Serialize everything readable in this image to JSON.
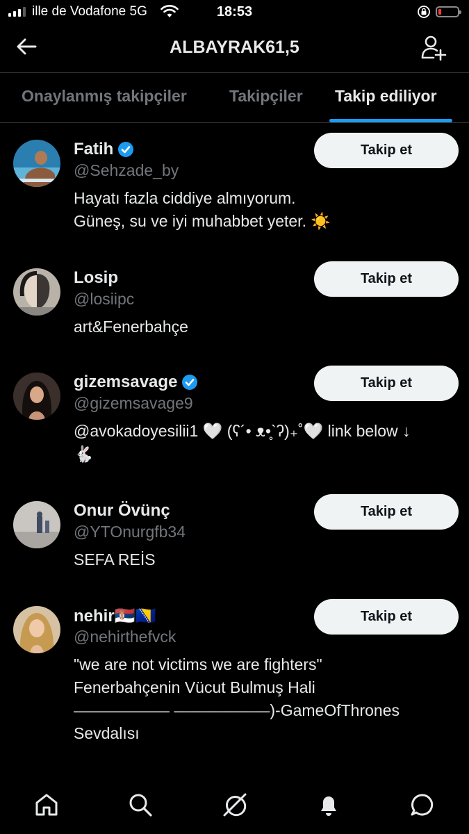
{
  "status_bar": {
    "carrier": "ille de Vodafone 5G",
    "time": "18:53"
  },
  "header": {
    "title": "ALBAYRAK61,5"
  },
  "tabs": [
    {
      "label": "Onaylanmış takipçiler"
    },
    {
      "label": "Takipçiler"
    },
    {
      "label": "Takip ediliyor"
    }
  ],
  "colors": {
    "accent": "#1d9bf0",
    "background": "#000000",
    "button_bg": "#eff3f4",
    "muted_text": "#71767b"
  },
  "users": [
    {
      "name": "Fatih",
      "handle": "@Sehzade_by",
      "verified": true,
      "bio": "Hayatı fazla ciddiye almıyorum.\nGüneş, su ve iyi muhabbet yeter. ☀️",
      "follow_label": "Takip et"
    },
    {
      "name": "Losip",
      "handle": "@losiipc",
      "verified": false,
      "bio": "art&Fenerbahçe",
      "follow_label": "Takip et"
    },
    {
      "name": "gizemsavage",
      "handle": "@gizemsavage9",
      "verified": true,
      "bio": "@avokadoyesilii1 🤍 (ʕ´• ᴥ•̥`ʔ)₊˚🤍 link below ↓\n🐇",
      "follow_label": "Takip et"
    },
    {
      "name": "Onur Övünç",
      "handle": "@YTOnurgfb34",
      "verified": false,
      "bio": "SEFA REİS",
      "follow_label": "Takip et"
    },
    {
      "name": "nehir🇷🇸🇧🇦",
      "handle": "@nehirthefvck",
      "verified": false,
      "bio": "\"we are not victims we are fighters\"\n Fenerbahçenin Vücut Bulmuş Hali\n—————— ——————)-GameOfThrones\nSevdalısı",
      "follow_label": "Takip et"
    }
  ],
  "bottom_nav": [
    {
      "icon": "home-icon"
    },
    {
      "icon": "search-icon"
    },
    {
      "icon": "spaces-icon"
    },
    {
      "icon": "notifications-icon"
    },
    {
      "icon": "messages-icon"
    }
  ]
}
